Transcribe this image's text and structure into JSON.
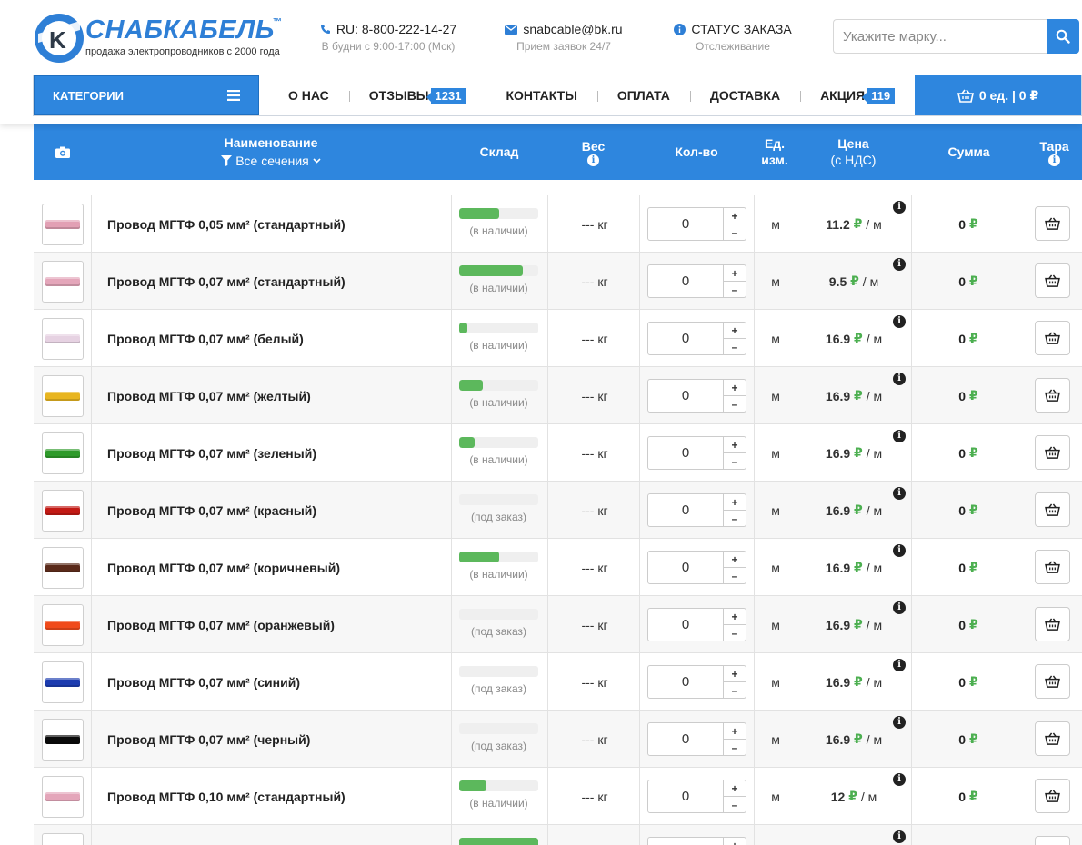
{
  "header": {
    "logo_text": "СНАБКАБЕЛЬ",
    "logo_tm": "™",
    "tagline": "продажа электропроводников с 2000 года",
    "phone": "RU: 8-800-222-14-27",
    "phone_sub": "В будни с 9:00-17:00 (Мск)",
    "email": "snabcable@bk.ru",
    "email_sub": "Прием заявок 24/7",
    "order_status": "СТАТУС ЗАКАЗА",
    "order_status_sub": "Отслеживание",
    "search_placeholder": "Укажите марку..."
  },
  "nav": {
    "categories": "КАТЕГОРИИ",
    "links": [
      {
        "label": "О НАС",
        "badge": ""
      },
      {
        "label": "ОТЗЫВЫ",
        "badge": "1231"
      },
      {
        "label": "КОНТАКТЫ",
        "badge": ""
      },
      {
        "label": "ОПЛАТА",
        "badge": ""
      },
      {
        "label": "ДОСТАВКА",
        "badge": ""
      },
      {
        "label": "АКЦИЯ",
        "badge": "119"
      }
    ],
    "cart": "0 ед.  |  0 ₽"
  },
  "table": {
    "col_name": "Наименование",
    "col_filter": "Все сечения",
    "col_stock": "Склад",
    "col_weight": "Вес",
    "col_qty": "Кол-во",
    "col_unit_1": "Ед.",
    "col_unit_2": "изм.",
    "col_price_1": "Цена",
    "col_price_2": "(с НДС)",
    "col_sum": "Сумма",
    "col_tara": "Тара"
  },
  "currency": "₽",
  "colors": {
    "accent": "#2e86de",
    "stock_bar": "#5cb85c",
    "ruble": "#4caf50"
  },
  "rows": [
    {
      "name": "Провод МГТФ 0,05 мм² (стандартный)",
      "color": "#e2a0b4",
      "stock_level": 0.5,
      "stock_label": "(в наличии)",
      "weight": "--- кг",
      "qty": "0",
      "unit": "м",
      "price": "11.2",
      "price_unit": "/ м",
      "sum": "0"
    },
    {
      "name": "Провод МГТФ 0,07 мм² (стандартный)",
      "color": "#e4a6ba",
      "stock_level": 0.8,
      "stock_label": "(в наличии)",
      "weight": "--- кг",
      "qty": "0",
      "unit": "м",
      "price": "9.5",
      "price_unit": "/ м",
      "sum": "0"
    },
    {
      "name": "Провод МГТФ 0,07 мм² (белый)",
      "color": "#e6d2e2",
      "stock_level": 0.1,
      "stock_label": "(в наличии)",
      "weight": "--- кг",
      "qty": "0",
      "unit": "м",
      "price": "16.9",
      "price_unit": "/ м",
      "sum": "0"
    },
    {
      "name": "Провод МГТФ 0,07 мм² (желтый)",
      "color": "#e8b520",
      "stock_level": 0.3,
      "stock_label": "(в наличии)",
      "weight": "--- кг",
      "qty": "0",
      "unit": "м",
      "price": "16.9",
      "price_unit": "/ м",
      "sum": "0"
    },
    {
      "name": "Провод МГТФ 0,07 мм² (зеленый)",
      "color": "#2e9a2a",
      "stock_level": 0.2,
      "stock_label": "(в наличии)",
      "weight": "--- кг",
      "qty": "0",
      "unit": "м",
      "price": "16.9",
      "price_unit": "/ м",
      "sum": "0"
    },
    {
      "name": "Провод МГТФ 0,07 мм² (красный)",
      "color": "#c21a14",
      "stock_level": 0,
      "stock_label": "(под заказ)",
      "weight": "--- кг",
      "qty": "0",
      "unit": "м",
      "price": "16.9",
      "price_unit": "/ м",
      "sum": "0"
    },
    {
      "name": "Провод МГТФ 0,07 мм² (коричневый)",
      "color": "#5a2a1a",
      "stock_level": 0.5,
      "stock_label": "(в наличии)",
      "weight": "--- кг",
      "qty": "0",
      "unit": "м",
      "price": "16.9",
      "price_unit": "/ м",
      "sum": "0"
    },
    {
      "name": "Провод МГТФ 0,07 мм² (оранжевый)",
      "color": "#f04a1a",
      "stock_level": 0,
      "stock_label": "(под заказ)",
      "weight": "--- кг",
      "qty": "0",
      "unit": "м",
      "price": "16.9",
      "price_unit": "/ м",
      "sum": "0"
    },
    {
      "name": "Провод МГТФ 0,07 мм² (синий)",
      "color": "#1c3cb0",
      "stock_level": 0,
      "stock_label": "(под заказ)",
      "weight": "--- кг",
      "qty": "0",
      "unit": "м",
      "price": "16.9",
      "price_unit": "/ м",
      "sum": "0"
    },
    {
      "name": "Провод МГТФ 0,07 мм² (черный)",
      "color": "#0a0a0a",
      "stock_level": 0,
      "stock_label": "(под заказ)",
      "weight": "--- кг",
      "qty": "0",
      "unit": "м",
      "price": "16.9",
      "price_unit": "/ м",
      "sum": "0"
    },
    {
      "name": "Провод МГТФ 0,10 мм² (стандартный)",
      "color": "#e4a6ba",
      "stock_level": 0.35,
      "stock_label": "(в наличии)",
      "weight": "--- кг",
      "qty": "0",
      "unit": "м",
      "price": "12",
      "price_unit": "/ м",
      "sum": "0"
    }
  ]
}
